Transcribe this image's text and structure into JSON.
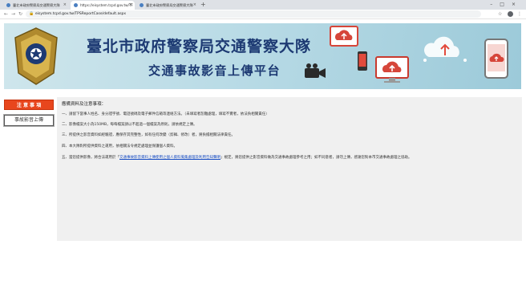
{
  "browser": {
    "tabs": [
      {
        "title": "臺北市政府警察局交通警察大隊",
        "active": false
      },
      {
        "title": "https://eisystem.tcpd.gov.tw/TF",
        "active": true
      },
      {
        "title": "臺北市政府警察局交通警察大隊",
        "active": false
      }
    ],
    "address": "eisystem.tcpd.gov.tw/TPSReportCase/default.aspx"
  },
  "banner": {
    "title_main": "臺北市政府警察局交通警察大隊",
    "title_sub": "交通事故影音上傳平台"
  },
  "sidebar": {
    "notice_label": "注 意 事 項",
    "upload_label": "事故影音上傳"
  },
  "main": {
    "heading": "應備資料及注意事項：",
    "rules": [
      {
        "text": "一、請留下當事人姓名、身分證字號、電話號碼及電子郵件信箱等連絡方法。（未填寫者恕難處理，填寫不實者，依法負相關責任）"
      },
      {
        "text": "二、影像檔案大小為150MB，每每檔案請以不超過一個檔案為原則，請依規定上傳。"
      },
      {
        "text": "三、所提供之影音資料如經驗證，應保存其完整性，如有任何改變（剪輯、修改）者，將負擔相關法律責任。"
      },
      {
        "text": "四、本大隊對所提供資料之運用，依相關法令規定處理並保護個人資料。"
      },
      {
        "text_before": "五、當您提供影像，將合法運用於「",
        "link": "交通事故影音資料上傳使用之個人資料蒐集處理及利用告知聲明",
        "text_after": "」規定，將您提供之影音資料做為交通事故處理參考之用；如不同意者，請勿上傳，感謝您對本市交通事故處理之協助。"
      }
    ]
  }
}
